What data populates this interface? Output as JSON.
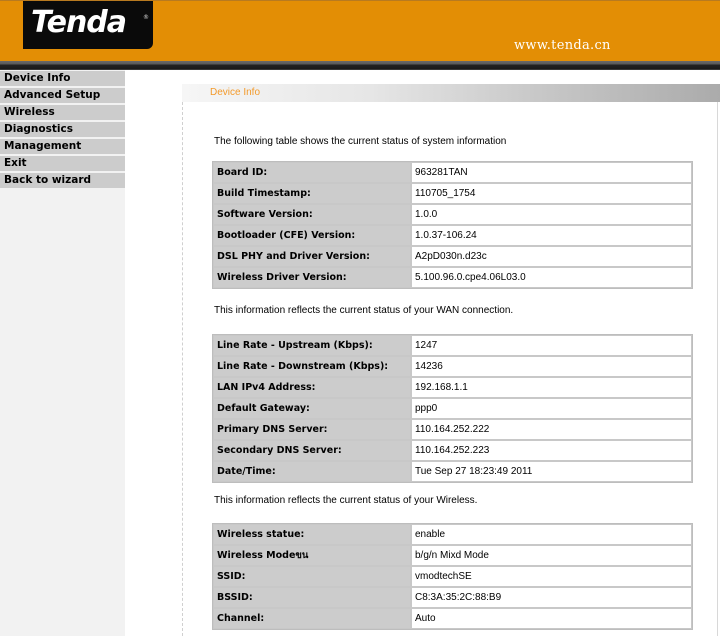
{
  "header": {
    "logo_text": "Tenda",
    "logo_mark": "®",
    "site_url": "www.tenda.cn",
    "brand_color": "#E38E05"
  },
  "sidebar": {
    "items": [
      {
        "label": "Device Info"
      },
      {
        "label": "Advanced Setup"
      },
      {
        "label": "Wireless"
      },
      {
        "label": "Diagnostics"
      },
      {
        "label": "Management"
      },
      {
        "label": "Exit"
      },
      {
        "label": "Back to wizard"
      }
    ]
  },
  "page": {
    "title": "Device Info",
    "title_color": "#F39A2B"
  },
  "system": {
    "description": "The following table shows the current status of system information",
    "rows": [
      {
        "label": "Board ID:",
        "value": "963281TAN"
      },
      {
        "label": "Build Timestamp:",
        "value": "110705_1754"
      },
      {
        "label": "Software Version:",
        "value": "1.0.0"
      },
      {
        "label": "Bootloader (CFE) Version:",
        "value": "1.0.37-106.24"
      },
      {
        "label": "DSL PHY and Driver Version:",
        "value": "A2pD030n.d23c"
      },
      {
        "label": "Wireless Driver Version:",
        "value": "5.100.96.0.cpe4.06L03.0"
      }
    ]
  },
  "wan": {
    "description": "This information reflects the current status of your WAN connection.",
    "rows": [
      {
        "label": "Line Rate - Upstream (Kbps):",
        "value": "1247"
      },
      {
        "label": "Line Rate - Downstream (Kbps):",
        "value": "14236"
      },
      {
        "label": "LAN IPv4 Address:",
        "value": "192.168.1.1"
      },
      {
        "label": "Default Gateway:",
        "value": "ppp0"
      },
      {
        "label": "Primary DNS Server:",
        "value": "110.164.252.222"
      },
      {
        "label": "Secondary DNS Server:",
        "value": "110.164.252.223"
      },
      {
        "label": "Date/Time:",
        "value": "Tue Sep 27 18:23:49 2011"
      }
    ]
  },
  "wireless": {
    "description": "This information reflects the current status of your Wireless.",
    "rows": [
      {
        "label": "Wireless statue:",
        "value": "enable"
      },
      {
        "label": "Wireless Modeขน",
        "value": "b/g/n Mixd Mode"
      },
      {
        "label": "SSID:",
        "value": "vmodtechSE"
      },
      {
        "label": "BSSID:",
        "value": "C8:3A:35:2C:88:B9"
      },
      {
        "label": "Channel:",
        "value": "Auto"
      }
    ]
  }
}
